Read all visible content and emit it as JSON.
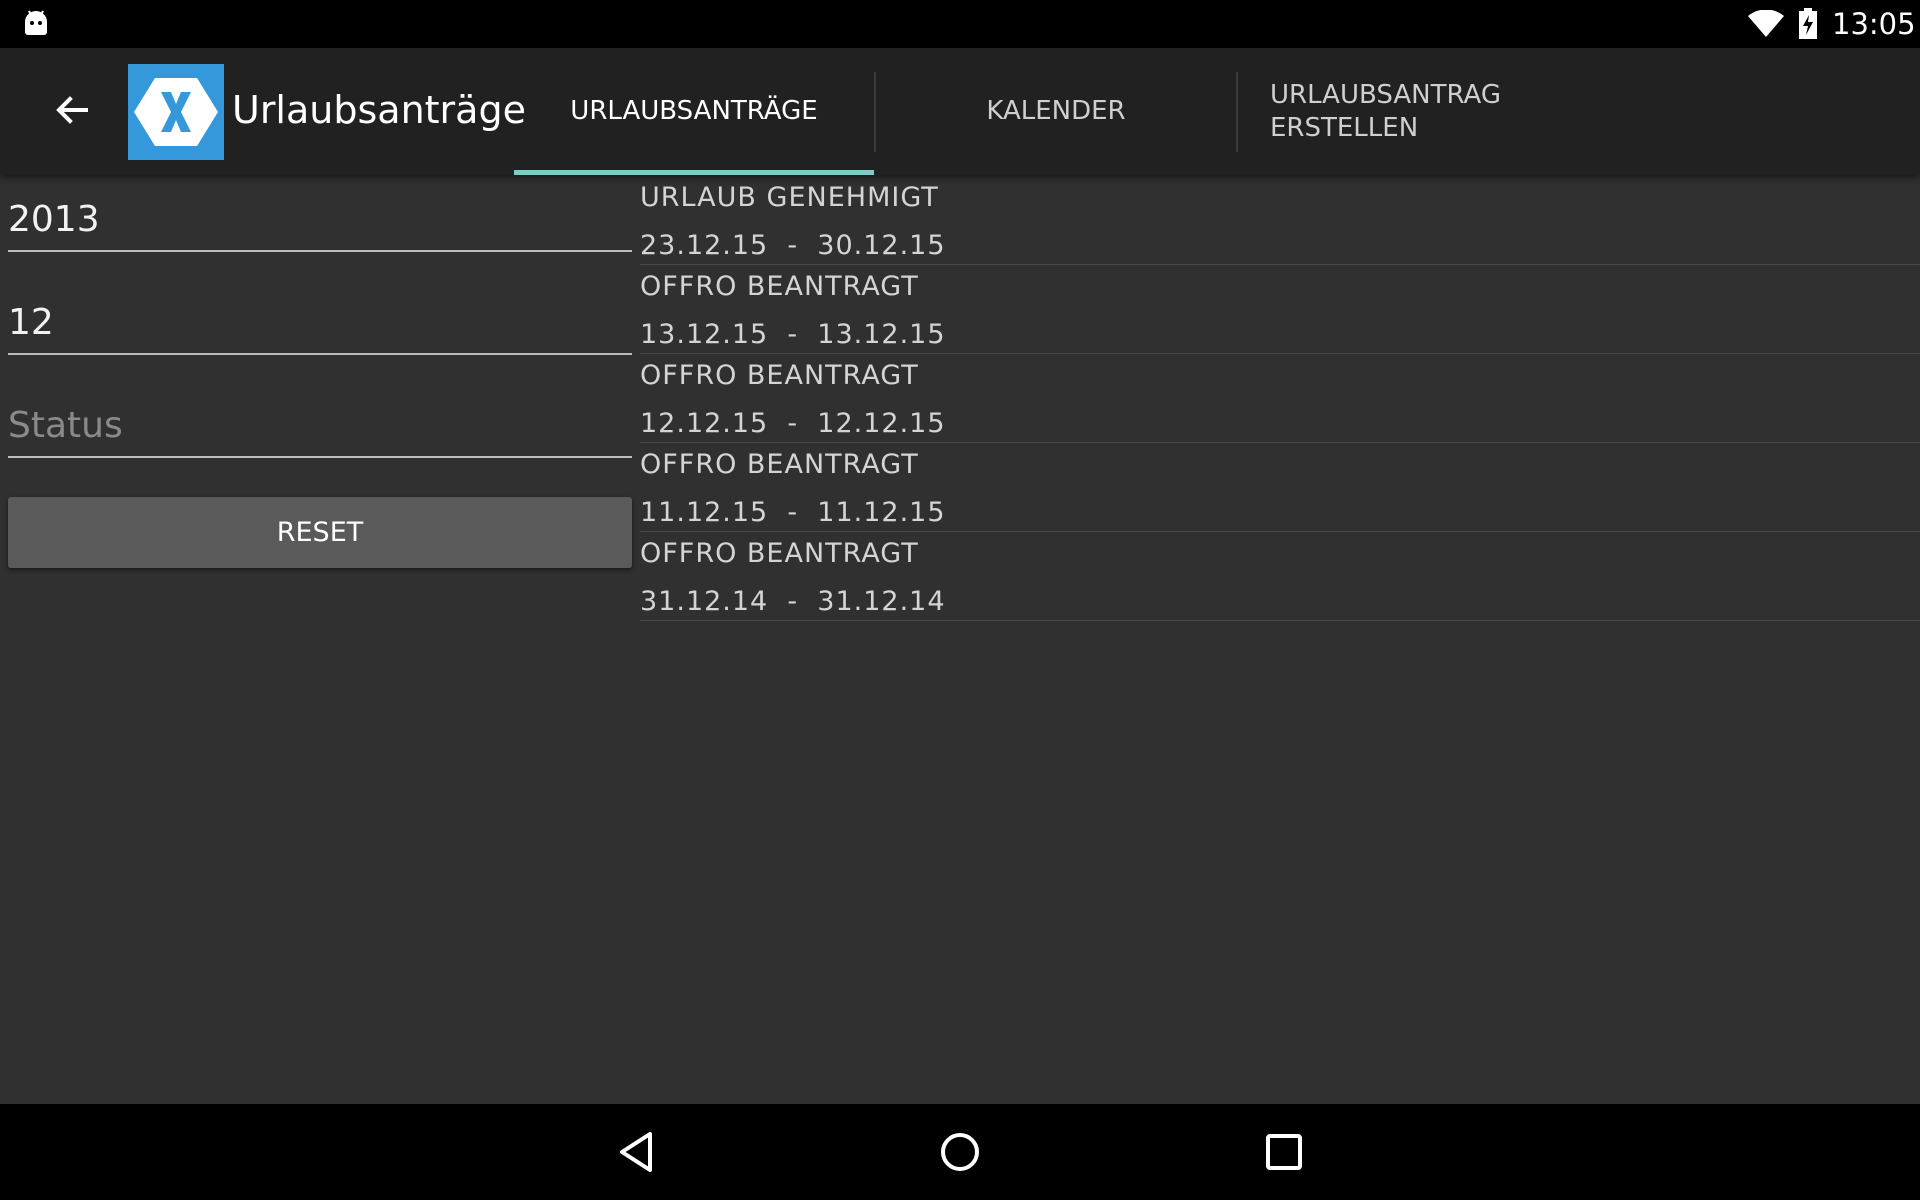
{
  "status_bar": {
    "time": "13:05",
    "icons": [
      "android-icon",
      "wifi-icon",
      "battery-charging-icon"
    ]
  },
  "action_bar": {
    "title": "Urlaubsanträge",
    "back_icon": "arrow-back-icon",
    "logo_icon": "xamarin-logo-icon",
    "logo_color": "#3498db",
    "tabs": [
      {
        "label": "URLAUBSANTRÄGE",
        "active": true
      },
      {
        "label": "KALENDER",
        "active": false
      },
      {
        "label": "URLAUBSANTRAG ERSTELLEN",
        "active": false
      }
    ],
    "indicator_color": "#80cbc4"
  },
  "filter": {
    "year": "2013",
    "month": "12",
    "status_placeholder": "Status",
    "reset_label": "RESET"
  },
  "requests": [
    {
      "status": "URLAUB  GENEHMIGT",
      "range": "23.12.15  -  30.12.15"
    },
    {
      "status": "OFFRO  BEANTRAGT",
      "range": "13.12.15  -  13.12.15"
    },
    {
      "status": "OFFRO  BEANTRAGT",
      "range": "12.12.15  -  12.12.15"
    },
    {
      "status": "OFFRO  BEANTRAGT",
      "range": "11.12.15  -  11.12.15"
    },
    {
      "status": "OFFRO  BEANTRAGT",
      "range": "31.12.14  -  31.12.14"
    }
  ],
  "nav_bar": {
    "icons": [
      "nav-back-icon",
      "nav-home-icon",
      "nav-recents-icon"
    ]
  }
}
